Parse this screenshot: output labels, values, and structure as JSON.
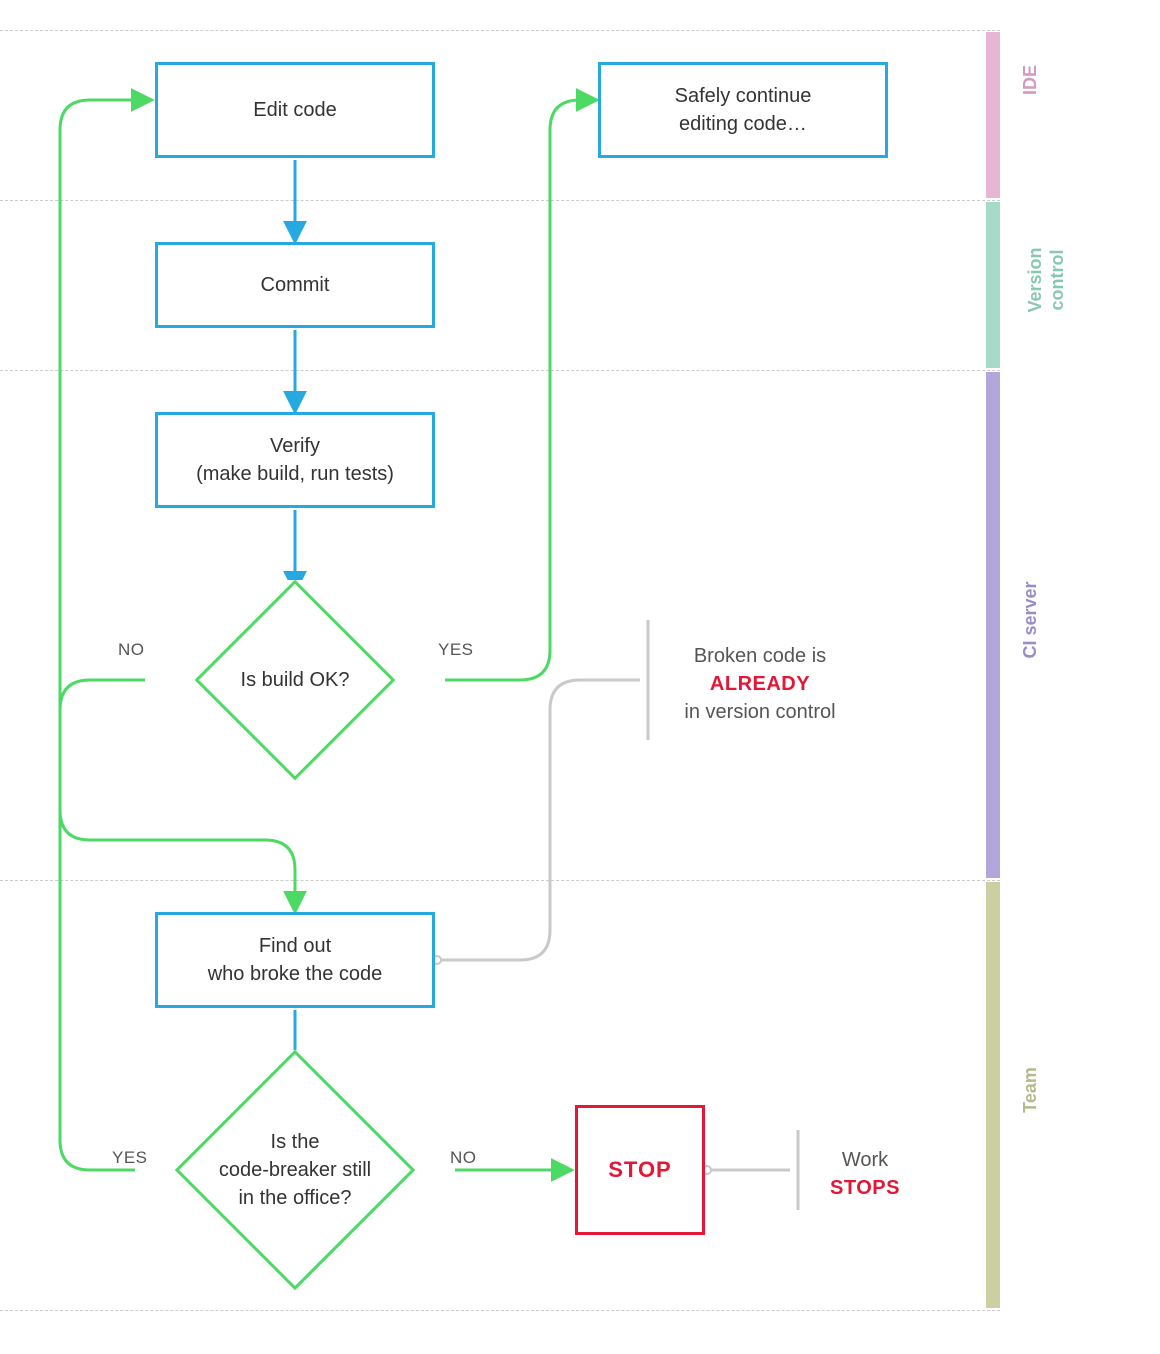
{
  "nodes": {
    "edit": "Edit code",
    "continue": "Safely continue\nediting code…",
    "commit": "Commit",
    "verify": "Verify\n(make build, run tests)",
    "buildOk": "Is build OK?",
    "findOut": "Find out\nwho broke the code",
    "inOffice": "Is the\ncode-breaker still\nin the office?",
    "stop": "STOP"
  },
  "edges": {
    "yes": "YES",
    "no": "NO"
  },
  "annotations": {
    "broken_line1": "Broken code is",
    "broken_strong": "ALREADY",
    "broken_line3": "in version control",
    "work_line1": "Work",
    "work_strong": "STOPS"
  },
  "lanes": {
    "ide": "IDE",
    "vcs": "Version\ncontrol",
    "ci": "CI server",
    "team": "Team"
  },
  "colors": {
    "blue": "#26a9e1",
    "green": "#4cd964",
    "red": "#e31837",
    "gray": "#bdbdbd",
    "lane_ide": "#e7b6d2",
    "lane_vcs": "#a6dbc9",
    "lane_ci": "#b2a6db",
    "lane_team": "#cbcfa2"
  }
}
